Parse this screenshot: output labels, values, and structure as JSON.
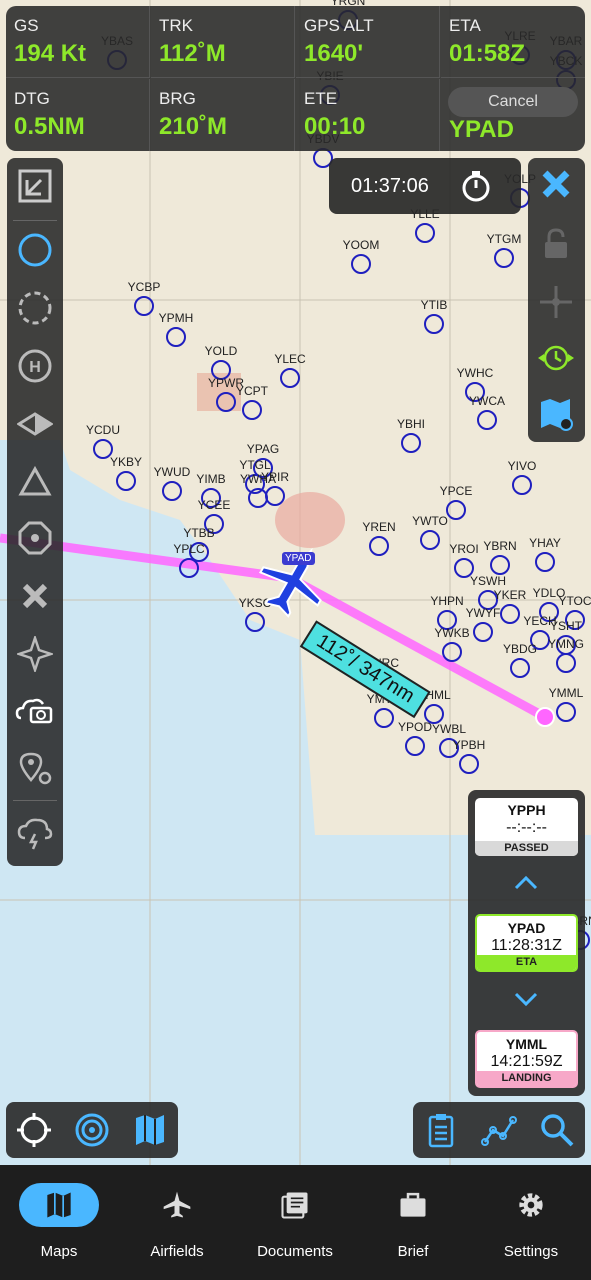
{
  "colors": {
    "accent_green": "#8ee82a",
    "route_magenta": "#ff66ff",
    "airfield_blue": "#1f1fbf",
    "cyan_active": "#4ab7ff"
  },
  "flight_panel": {
    "gs": {
      "label": "GS",
      "value": "194 Kt"
    },
    "trk": {
      "label": "TRK",
      "value": "112˚M"
    },
    "gps_alt": {
      "label": "GPS ALT",
      "value": "1640'"
    },
    "eta": {
      "label": "ETA",
      "value": "01:58Z"
    },
    "dtg": {
      "label": "DTG",
      "value": "0.5NM"
    },
    "brg": {
      "label": "BRG",
      "value": "210˚M"
    },
    "ete": {
      "label": "ETE",
      "value": "00:10"
    },
    "dest": {
      "value": "YPAD"
    },
    "cancel_label": "Cancel"
  },
  "timer": {
    "value": "01:37:06",
    "icon": "stopwatch-icon"
  },
  "route_label": "112˚/ 347nm",
  "airfields": [
    {
      "id": "YBAS"
    },
    {
      "id": "YBIE"
    },
    {
      "id": "YRGN"
    },
    {
      "id": "YLRE"
    },
    {
      "id": "YBAR"
    },
    {
      "id": "YBCK"
    },
    {
      "id": "YBDV"
    },
    {
      "id": "YOLP"
    },
    {
      "id": "YLLE"
    },
    {
      "id": "YOOM"
    },
    {
      "id": "YTGM"
    },
    {
      "id": "YCBP"
    },
    {
      "id": "YPMH"
    },
    {
      "id": "YTIB"
    },
    {
      "id": "YOLD"
    },
    {
      "id": "YLEC"
    },
    {
      "id": "YPWR"
    },
    {
      "id": "YCPT"
    },
    {
      "id": "YWHC"
    },
    {
      "id": "YWCA"
    },
    {
      "id": "YBHI"
    },
    {
      "id": "YCDU"
    },
    {
      "id": "YPAG"
    },
    {
      "id": "YTGL"
    },
    {
      "id": "YWHA"
    },
    {
      "id": "YKBY"
    },
    {
      "id": "YWUD"
    },
    {
      "id": "YIMB"
    },
    {
      "id": "YPIR"
    },
    {
      "id": "YIVO"
    },
    {
      "id": "YPCE"
    },
    {
      "id": "YCEE"
    },
    {
      "id": "YREN"
    },
    {
      "id": "YWTO"
    },
    {
      "id": "YTBB"
    },
    {
      "id": "YHAY"
    },
    {
      "id": "YPLC"
    },
    {
      "id": "YROI"
    },
    {
      "id": "YBRN"
    },
    {
      "id": "YSWH"
    },
    {
      "id": "YKSC"
    },
    {
      "id": "YHPN"
    },
    {
      "id": "YKER"
    },
    {
      "id": "YDLO"
    },
    {
      "id": "YTOC"
    },
    {
      "id": "YWKB"
    },
    {
      "id": "YECH"
    },
    {
      "id": "YSHT"
    },
    {
      "id": "YBDG"
    },
    {
      "id": "YMNG"
    },
    {
      "id": "YNRC"
    },
    {
      "id": "YMTG"
    },
    {
      "id": "YHML"
    },
    {
      "id": "YMML"
    },
    {
      "id": "YPOD"
    },
    {
      "id": "YWBL"
    },
    {
      "id": "YPBH"
    },
    {
      "id": "YWYF"
    },
    {
      "id": "YSRN"
    }
  ],
  "aircraft": {
    "tag": "YPAD"
  },
  "waypoints": [
    {
      "id": "YPPH",
      "time": "--:--:--",
      "status": "PASSED",
      "status_color": "#d9d9d9"
    },
    {
      "id": "YPAD",
      "time": "11:28:31Z",
      "status": "ETA",
      "status_color": "#8ee82a"
    },
    {
      "id": "YMML",
      "time": "14:21:59Z",
      "status": "LANDING",
      "status_color": "#f7a8c8"
    }
  ],
  "nav": [
    {
      "label": "Maps",
      "icon": "map-icon",
      "active": true
    },
    {
      "label": "Airfields",
      "icon": "airplane-icon",
      "active": false
    },
    {
      "label": "Documents",
      "icon": "documents-icon",
      "active": false
    },
    {
      "label": "Brief",
      "icon": "briefcase-icon",
      "active": false
    },
    {
      "label": "Settings",
      "icon": "gear-icon",
      "active": false
    }
  ]
}
